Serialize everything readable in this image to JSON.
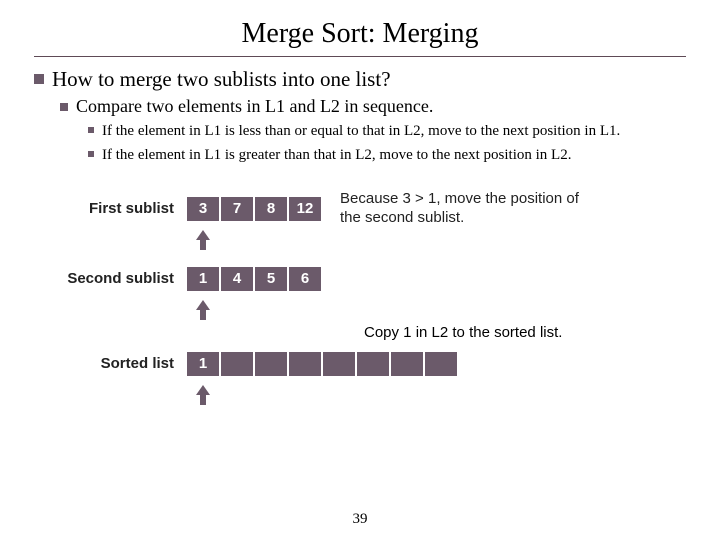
{
  "title": "Merge Sort: Merging",
  "bullets": {
    "b0": "How to merge two sublists into one list?",
    "b1": "Compare two elements in L1 and L2 in sequence.",
    "b2a": "If the element in L1 is less than or equal to that in L2, move to the next position in L1.",
    "b2b": "If the element in L1 is greater than that in L2, move to the next position in L2."
  },
  "labels": {
    "first": "First sublist",
    "second": "Second sublist",
    "sorted": "Sorted list"
  },
  "first_sublist": [
    "3",
    "7",
    "8",
    "12"
  ],
  "second_sublist": [
    "1",
    "4",
    "5",
    "6"
  ],
  "sorted_list": [
    "1",
    "",
    "",
    "",
    "",
    "",
    "",
    ""
  ],
  "note1": "Because 3 > 1, move the position of the second sublist.",
  "note2": "Copy 1 in L2 to the sorted list.",
  "page": "39",
  "colors": {
    "cell_bg": "#6b5a6a"
  }
}
